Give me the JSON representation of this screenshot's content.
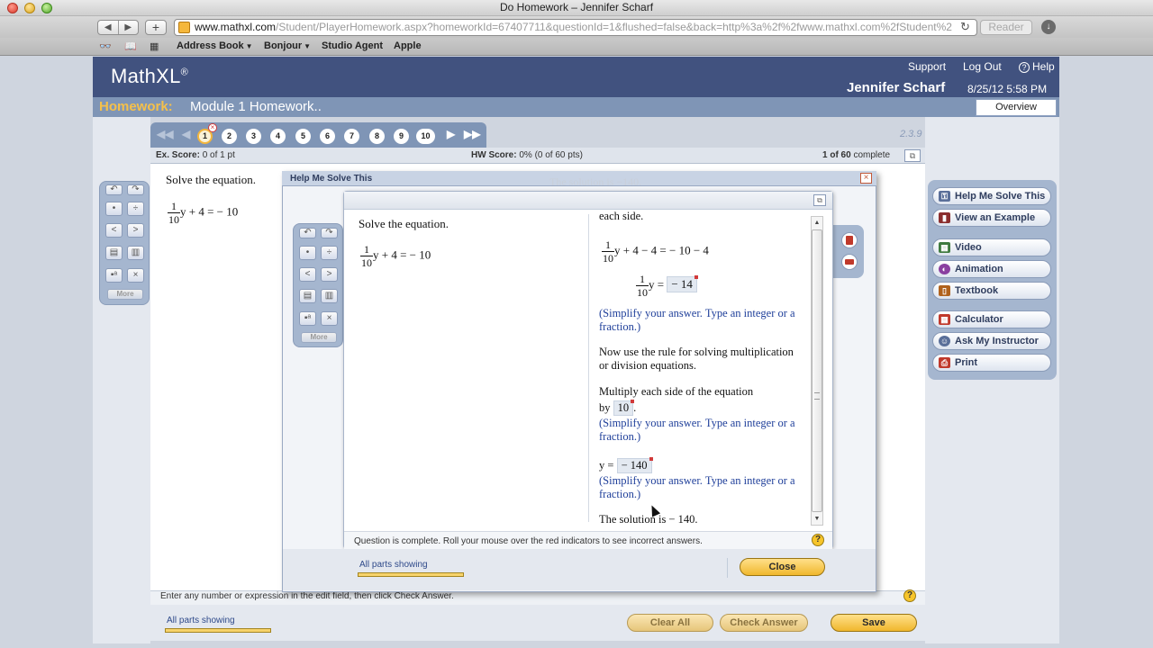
{
  "browser": {
    "window_title": "Do Homework – Jennifer Scharf",
    "url_domain": "www.mathxl.com",
    "url_path": "/Student/PlayerHomework.aspx?homeworkId=67407711&questionId=1&flushed=false&back=http%3a%2f%2fwww.mathxl.com%2fStudent%2",
    "reader_label": "Reader",
    "bookmarks": [
      {
        "label": "Address Book",
        "has_menu": true
      },
      {
        "label": "Bonjour",
        "has_menu": true
      },
      {
        "label": "Studio Agent",
        "has_menu": false
      },
      {
        "label": "Apple",
        "has_menu": false
      }
    ]
  },
  "app": {
    "logo": "MathXL",
    "logo_mark": "®",
    "links": {
      "support": "Support",
      "logout": "Log Out",
      "help": "Help"
    },
    "user_name": "Jennifer Scharf",
    "datetime": "8/25/12 5:58 PM",
    "homework_label": "Homework:",
    "homework_title": "Module 1 Homework..",
    "overview_label": "Overview",
    "version": "2.3.9"
  },
  "question_nav": {
    "numbers": [
      "1",
      "2",
      "3",
      "4",
      "5",
      "6",
      "7",
      "8",
      "9",
      "10"
    ],
    "current": "1"
  },
  "scores": {
    "ex_label": "Ex. Score:",
    "ex_value": "0 of 1 pt",
    "hw_label": "HW Score:",
    "hw_value": "0% (0 of 60 pts)",
    "complete_count": "1 of 60",
    "complete_label": "complete"
  },
  "question": {
    "prompt": "Solve the equation.",
    "frac_num": "1",
    "frac_den": "10",
    "equation_rest": "y + 4 = − 10"
  },
  "palette": {
    "more_label": "More"
  },
  "tools": [
    {
      "label": "Help Me Solve This",
      "icon": "key-icon",
      "color": "#5a6f99"
    },
    {
      "label": "View an Example",
      "icon": "book-icon",
      "color": "#8b2e2e"
    },
    {
      "label": "Video",
      "icon": "film-icon",
      "color": "#3f7a3f"
    },
    {
      "label": "Animation",
      "icon": "animation-icon",
      "color": "#8a3fa0"
    },
    {
      "label": "Textbook",
      "icon": "textbook-icon",
      "color": "#b0621d"
    },
    {
      "label": "Calculator",
      "icon": "calculator-icon",
      "color": "#c0392b"
    },
    {
      "label": "Ask My Instructor",
      "icon": "person-icon",
      "color": "#5a6f99"
    },
    {
      "label": "Print",
      "icon": "printer-icon",
      "color": "#c0392b"
    }
  ],
  "footer": {
    "instruction": "Enter any number or expression in the edit field, then click Check Answer.",
    "all_parts": "All parts showing",
    "clear_all": "Clear All",
    "check_answer": "Check Answer",
    "save": "Save"
  },
  "dialog": {
    "title": "Help Me Solve This",
    "ghost_text": "The solution is −140.",
    "left_prompt": "Solve the equation.",
    "left_frac_num": "1",
    "left_frac_den": "10",
    "left_equation_rest": "y + 4 = − 10",
    "sol_top": "each side.",
    "step1_num": "1",
    "step1_den": "10",
    "step1_rest": "y + 4 − 4  =  − 10 − 4",
    "step2_num": "1",
    "step2_den": "10",
    "step2_rest": "y  =",
    "step2_answer": "− 14",
    "simplify_note": "(Simplify your answer. Type an integer or a fraction.)",
    "rule_text": "Now use the rule for solving multiplication or division equations.",
    "multiply_text": "Multiply each side of the equation",
    "by_label": "by",
    "by_answer": "10",
    "by_period": ".",
    "y_label": "y =",
    "y_answer": "− 140",
    "solution_text": "The solution is − 140.",
    "status": "Question is complete.  Roll your mouse over the red indicators to see incorrect answers.",
    "all_parts": "All parts showing",
    "close_label": "Close"
  },
  "colors": {
    "header_blue": "#41527f",
    "bar_blue": "#7f95b6",
    "homework_gold": "#f5c04a",
    "note_blue": "#1f3f9a"
  }
}
